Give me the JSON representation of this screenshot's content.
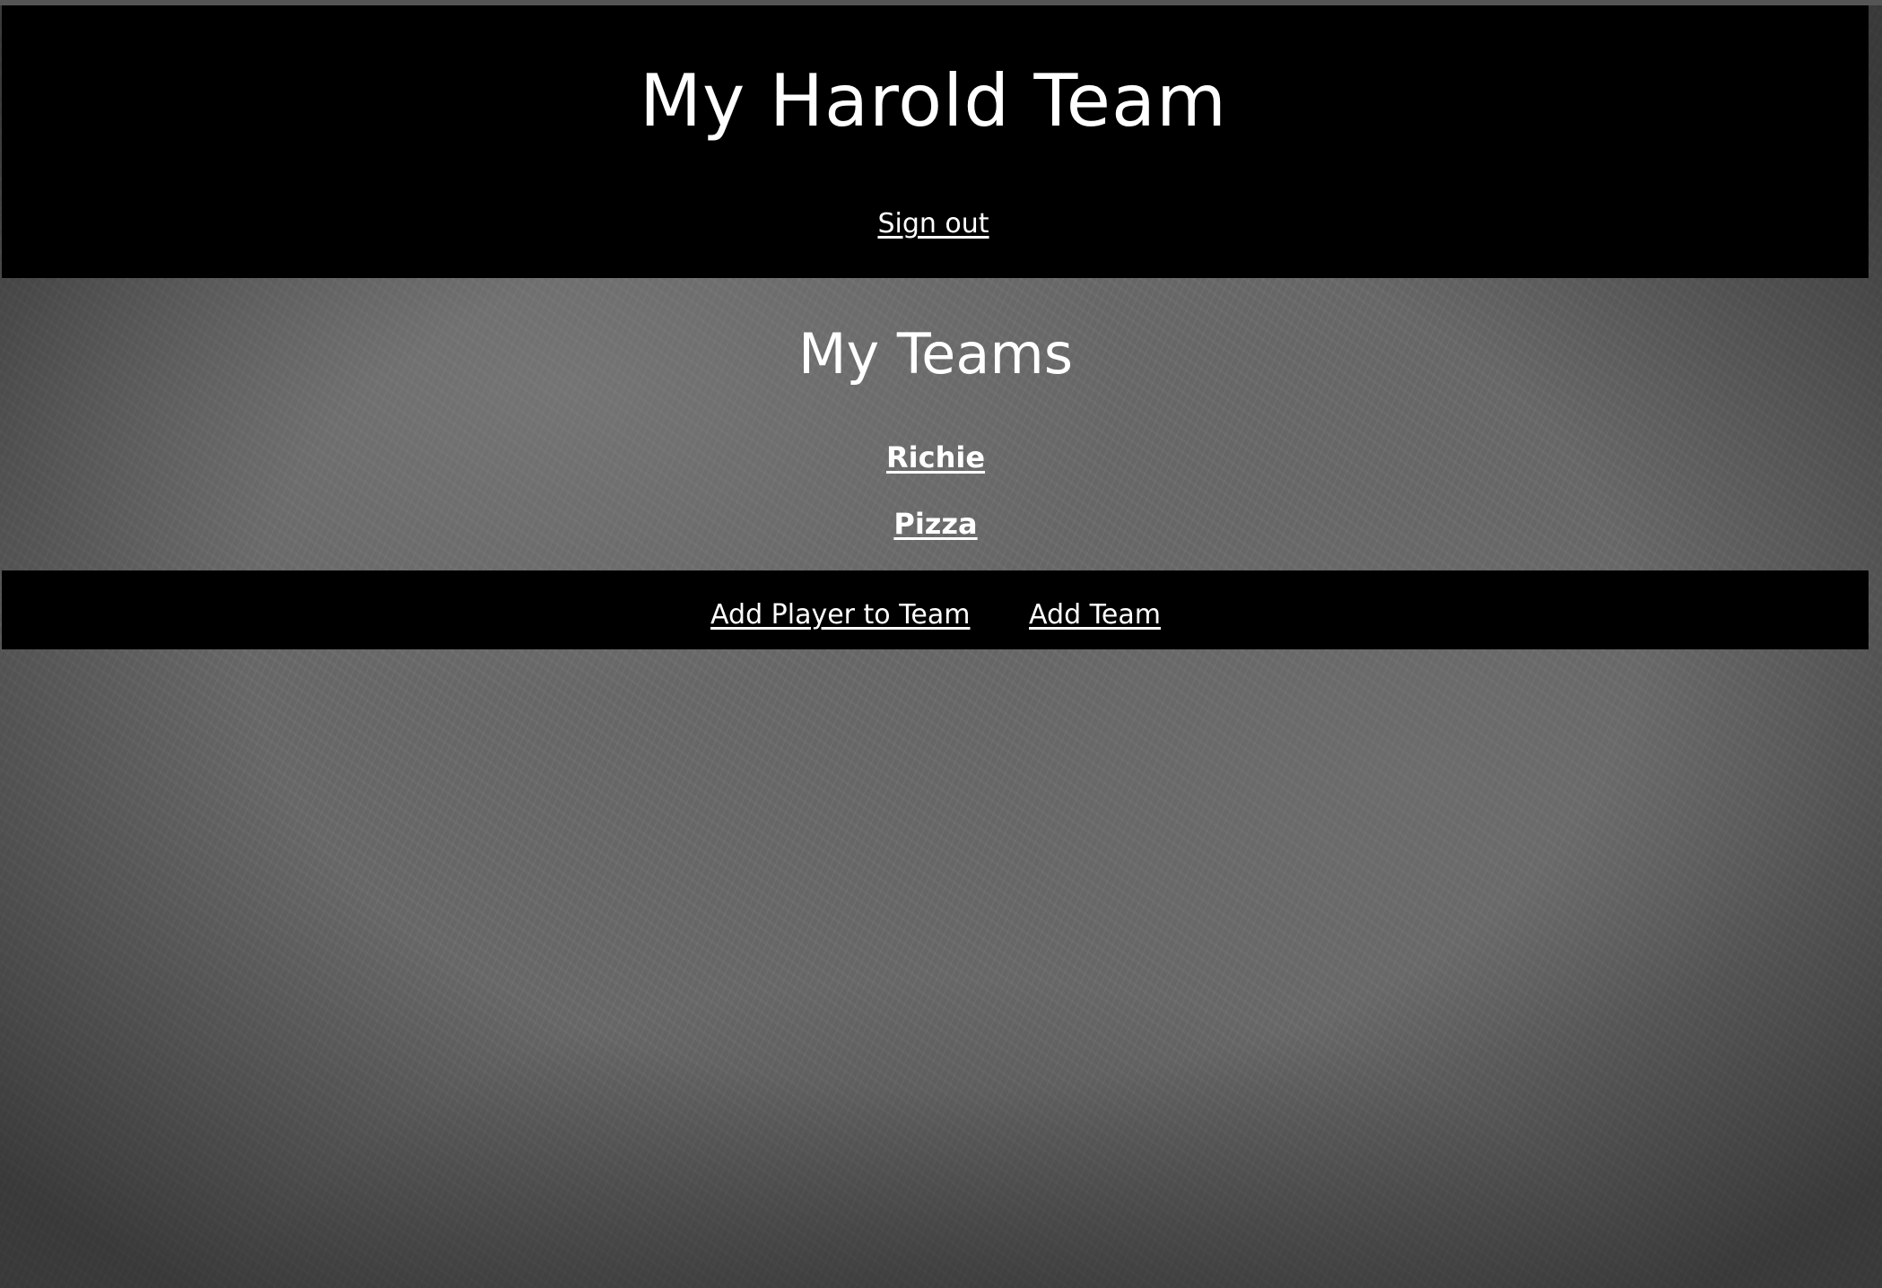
{
  "header": {
    "title": "My Harold Team",
    "sign_out_label": "Sign out"
  },
  "main": {
    "heading": "My Teams",
    "teams": [
      {
        "name": "Richie"
      },
      {
        "name": "Pizza"
      }
    ]
  },
  "footer": {
    "add_player_label": "Add Player to Team",
    "add_team_label": "Add Team"
  },
  "colors": {
    "banner_background": "#000000",
    "text": "#ffffff",
    "chalkboard": "#6a6a6a"
  }
}
